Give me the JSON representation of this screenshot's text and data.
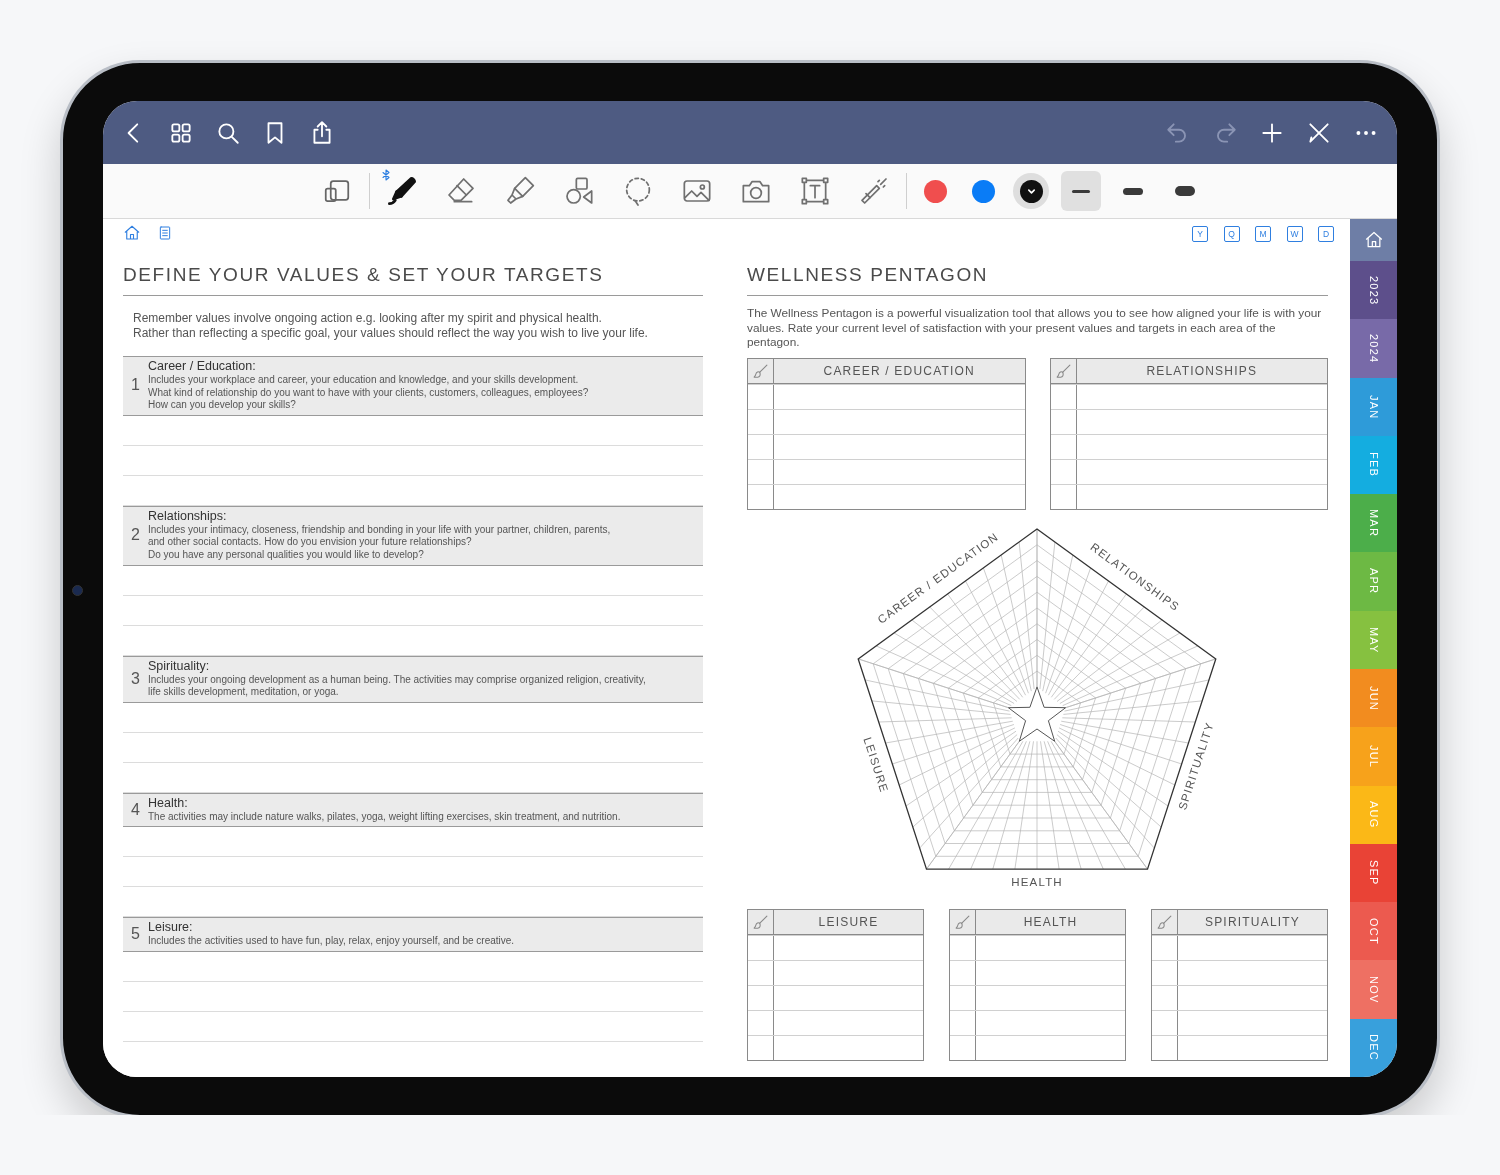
{
  "top_bar": {
    "left_buttons": [
      {
        "kind": "back"
      },
      {
        "kind": "grid"
      },
      {
        "kind": "search"
      },
      {
        "kind": "bookmark"
      },
      {
        "kind": "share"
      }
    ],
    "right_buttons": [
      {
        "kind": "undo",
        "disabled": true
      },
      {
        "kind": "redo",
        "disabled": true
      },
      {
        "kind": "add",
        "disabled": false
      },
      {
        "kind": "pen-off",
        "disabled": false
      },
      {
        "kind": "more",
        "disabled": false
      }
    ]
  },
  "toolbar": {
    "tools": [
      {
        "kind": "pen",
        "selected": true,
        "bluetooth": true
      },
      {
        "kind": "eraser",
        "selected": false,
        "bluetooth": false
      },
      {
        "kind": "highlighter",
        "selected": false,
        "bluetooth": false
      },
      {
        "kind": "shapes",
        "selected": false,
        "bluetooth": false
      },
      {
        "kind": "lasso",
        "selected": false,
        "bluetooth": false
      },
      {
        "kind": "image",
        "selected": false,
        "bluetooth": false
      },
      {
        "kind": "camera",
        "selected": false,
        "bluetooth": false
      },
      {
        "kind": "text",
        "selected": false,
        "bluetooth": false
      },
      {
        "kind": "laser",
        "selected": false,
        "bluetooth": false
      }
    ],
    "colors": [
      {
        "color": "#f04e4e",
        "selected": false
      },
      {
        "color": "#0a7cf6",
        "selected": false
      },
      {
        "color": "#111111",
        "selected": true
      }
    ],
    "strokes": [
      {
        "kind": "thin",
        "selected": true
      },
      {
        "kind": "medium",
        "selected": false
      },
      {
        "kind": "thick",
        "selected": false
      }
    ]
  },
  "page": {
    "view_links": [
      "Y",
      "Q",
      "M",
      "W",
      "D"
    ],
    "values": {
      "title": "DEFINE YOUR VALUES & SET YOUR TARGETS",
      "intro": "Remember values involve ongoing action e.g. looking after my spirit and physical health.\nRather than reflecting a specific goal, your values should reflect the way you wish to live your life.",
      "sections": [
        {
          "number": "1",
          "title": "Career / Education:",
          "description": "Includes your workplace and career, your education and knowledge, and your skills development.\nWhat kind of relationship do you want to have with your clients, customers, colleagues, employees?\nHow can you develop your skills?"
        },
        {
          "number": "2",
          "title": "Relationships:",
          "description": "Includes your intimacy, closeness, friendship and bonding in your life with your partner, children, parents,\nand other social contacts. How do you envision your future relationships?\nDo you have any personal qualities you would like to develop?"
        },
        {
          "number": "3",
          "title": "Spirituality:",
          "description": "Includes your ongoing development as a human being. The activities may comprise organized religion, creativity,\nlife skills development, meditation, or yoga."
        },
        {
          "number": "4",
          "title": "Health:",
          "description": "The activities may include nature walks, pilates, yoga, weight lifting exercises, skin treatment, and nutrition."
        },
        {
          "number": "5",
          "title": "Leisure:",
          "description": "Includes the activities used to have fun, play, relax, enjoy yourself, and be creative."
        }
      ]
    },
    "pentagon": {
      "title": "WELLNESS PENTAGON",
      "description": "The Wellness Pentagon is a powerful visualization tool that allows you to see how aligned your life is with your values. Rate your current level of satisfaction with your present values and targets in each area of the pentagon.",
      "top_tables": [
        {
          "title": "CAREER / EDUCATION"
        },
        {
          "title": "RELATIONSHIPS"
        }
      ],
      "axis_labels": [
        "CAREER / EDUCATION",
        "RELATIONSHIPS",
        "SPIRITUALITY",
        "HEALTH",
        "LEISURE"
      ],
      "bottom_tables": [
        {
          "title": "LEISURE"
        },
        {
          "title": "HEALTH"
        },
        {
          "title": "SPIRITUALITY"
        }
      ]
    }
  },
  "side_tabs": [
    {
      "label": "2023",
      "color": "#5d4f8b"
    },
    {
      "label": "2024",
      "color": "#786aa8"
    },
    {
      "label": "JAN",
      "color": "#2e9bd9"
    },
    {
      "label": "FEB",
      "color": "#14ade0"
    },
    {
      "label": "MAR",
      "color": "#4cae4a"
    },
    {
      "label": "APR",
      "color": "#6db944"
    },
    {
      "label": "MAY",
      "color": "#86c140"
    },
    {
      "label": "JUN",
      "color": "#f28c1f"
    },
    {
      "label": "JUL",
      "color": "#f7a21b"
    },
    {
      "label": "AUG",
      "color": "#fbb817"
    },
    {
      "label": "SEP",
      "color": "#e94336"
    },
    {
      "label": "OCT",
      "color": "#ec5a4f"
    },
    {
      "label": "NOV",
      "color": "#ee7063"
    },
    {
      "label": "DEC",
      "color": "#38a0dc"
    }
  ]
}
